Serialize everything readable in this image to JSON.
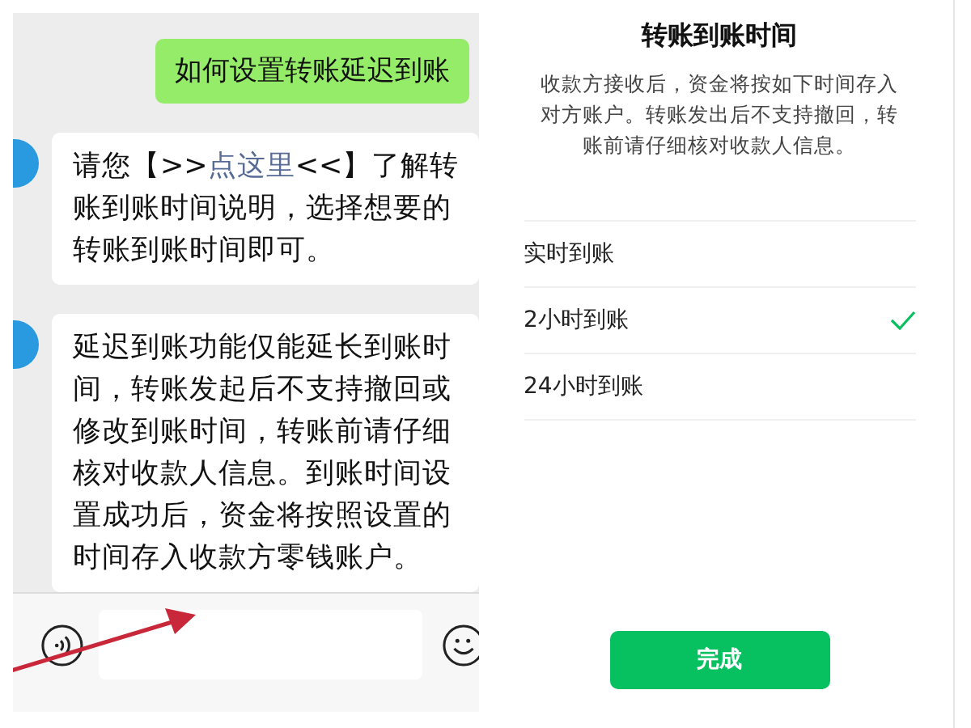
{
  "chat": {
    "messages": [
      {
        "outgoing": true,
        "parts": [
          {
            "kind": "text",
            "text": "如何设置转账延迟到账"
          }
        ]
      },
      {
        "outgoing": false,
        "parts": [
          {
            "kind": "text",
            "text": "请您【>>"
          },
          {
            "kind": "link",
            "text": "点这里"
          },
          {
            "kind": "text",
            "text": "<<】了解转账到账时间说明，选择想要的转账到账时间即可。"
          }
        ]
      },
      {
        "outgoing": false,
        "parts": [
          {
            "kind": "text",
            "text": "延迟到账功能仅能延长到账时间，转账发起后不支持撤回或修改到账时间，转账前请仔细核对收款人信息。到账时间设置成功后，资金将按照设置的时间存入收款方零钱账户。"
          }
        ]
      }
    ]
  },
  "sheet": {
    "title": "转账到账时间",
    "description": "收款方接收后，资金将按如下时间存入对方账户。转账发出后不支持撤回，转账前请仔细核对收款人信息。",
    "options": [
      {
        "label": "实时到账",
        "selected": false
      },
      {
        "label": "2小时到账",
        "selected": true
      },
      {
        "label": "24小时到账",
        "selected": false
      }
    ],
    "button": "完成"
  }
}
